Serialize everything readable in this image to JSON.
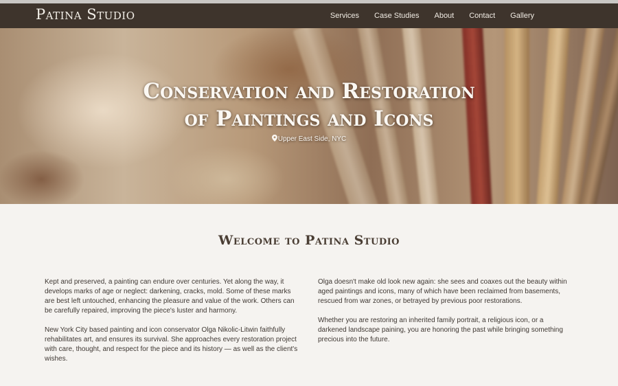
{
  "header": {
    "logo": "Patina Studio",
    "nav": [
      "Services",
      "Case Studies",
      "About",
      "Contact",
      "Gallery"
    ]
  },
  "hero": {
    "title_line1": "Conservation and Restoration",
    "title_line2": "of Paintings and Icons",
    "location": "Upper East Side, NYC"
  },
  "main": {
    "heading": "Welcome to Patina Studio",
    "left_paragraphs": [
      "Kept and preserved, a painting can endure over centuries. Yet along the way, it develops marks of age or neglect: darkening, cracks, mold. Some of these marks are best left untouched, enhancing the pleasure and value of the work. Others can be carefully repaired, improving the piece's luster and harmony.",
      "New York City based painting and icon conservator Olga Nikolic-Litwin faithfully rehabilitates art, and ensures its survival. She approaches every restoration project with care, thought, and respect for the piece and its history — as well as the client's wishes."
    ],
    "right_paragraphs": [
      "Olga doesn't make old look new again: she sees and coaxes out the beauty within aged paintings and icons, many of which have been reclaimed from basements, rescued from war zones, or betrayed by previous poor restorations.",
      "Whether you are restoring an inherited family portrait, a religious icon, or a darkened landscape paining, you are honoring the past while bringing something precious into the future."
    ]
  },
  "colors": {
    "navbar": "#3e342c",
    "page_background": "#f5f3f0",
    "heading_text": "#4a3e34"
  },
  "icons": [
    "map-pin-icon"
  ]
}
